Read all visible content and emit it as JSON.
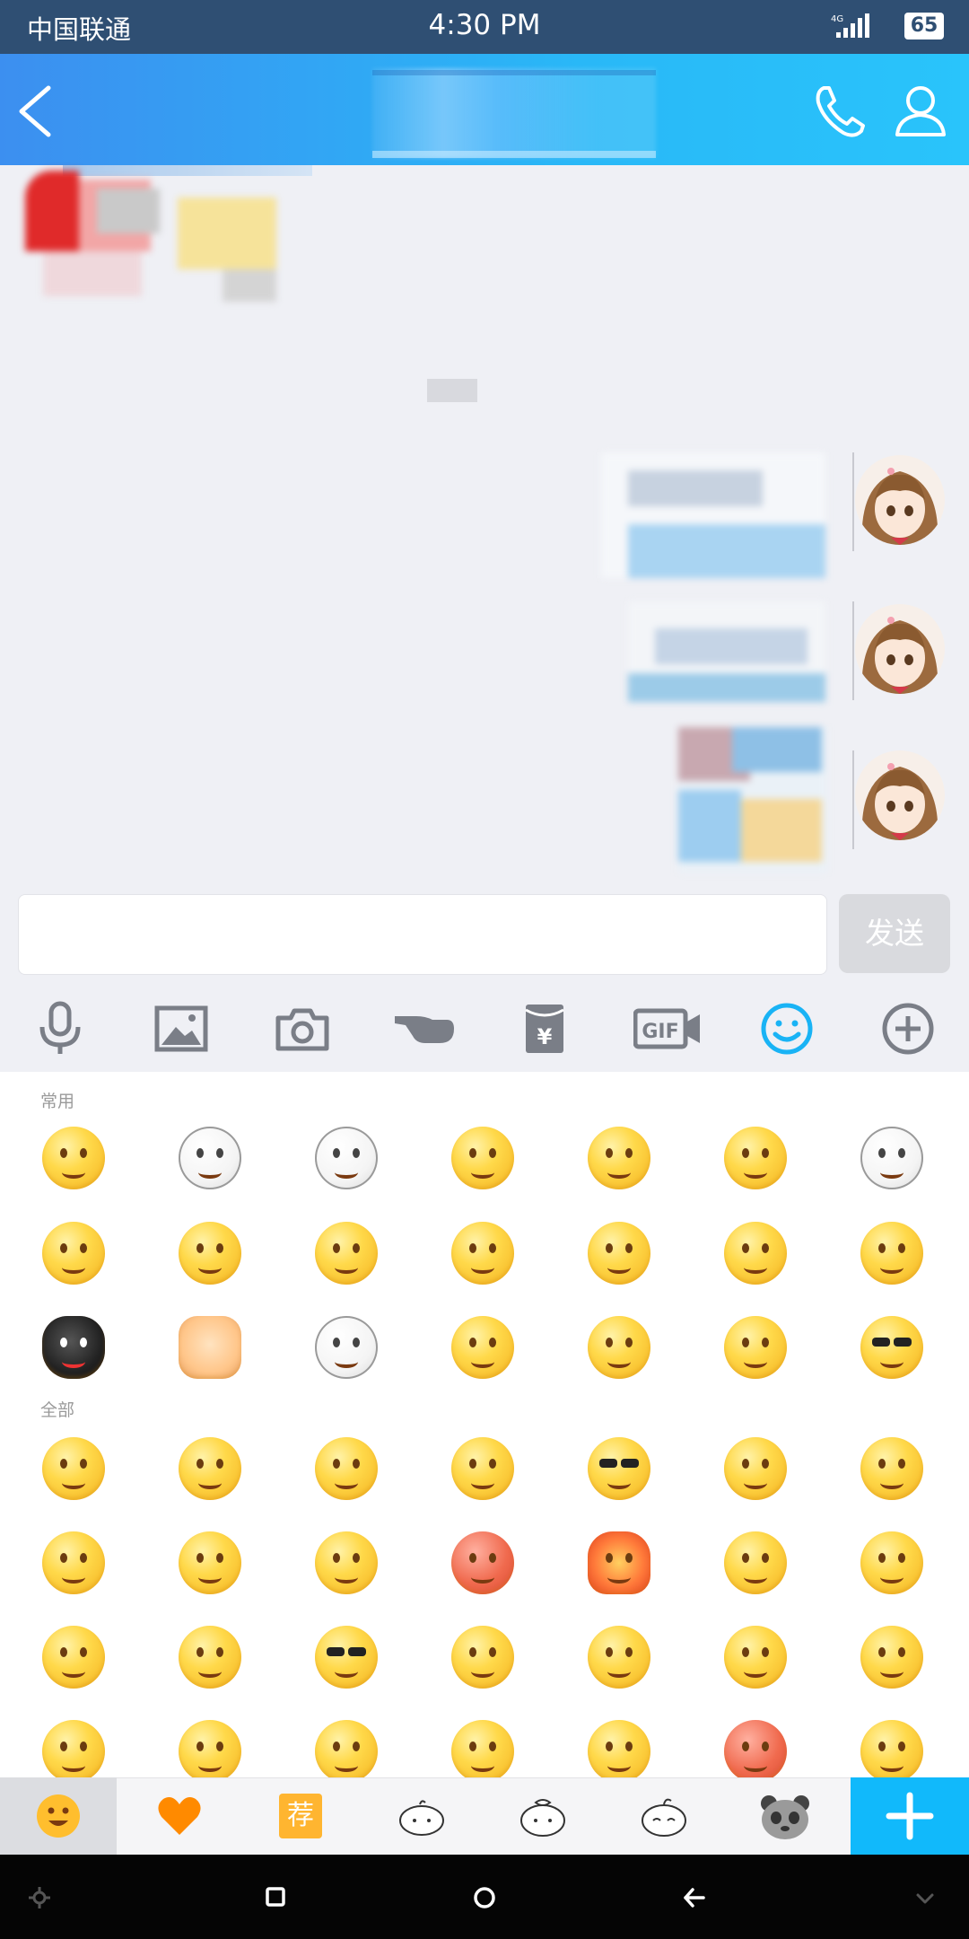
{
  "status_bar": {
    "carrier": "中国联通",
    "time": "4:30 PM",
    "network": "4G",
    "battery": "65"
  },
  "header": {
    "back_icon": "chevron-left-icon",
    "call_icon": "phone-icon",
    "profile_icon": "person-icon"
  },
  "chat": {
    "received_messages": 1,
    "sent_messages": 3
  },
  "composer": {
    "input_value": "",
    "send_label": "发送"
  },
  "toolbar": {
    "items": [
      "microphone-icon",
      "image-icon",
      "camera-icon",
      "poke-icon",
      "red-envelope-icon",
      "gif-icon",
      "emoji-icon",
      "plus-icon"
    ],
    "active": "emoji-icon"
  },
  "emoji_panel": {
    "section_recent": "常用",
    "section_all": "全部"
  },
  "emoji_tabs": {
    "items": [
      "smiley-icon",
      "heart-icon",
      "recommend-icon",
      "sticker-bun-1-icon",
      "sticker-bun-2-icon",
      "sticker-bun-3-icon",
      "panda-sticker-icon"
    ],
    "recommend_label": "荐",
    "add_icon": "plus-icon"
  },
  "colors": {
    "status_bg": "#2f4f73",
    "header_start": "#3c8ff0",
    "header_end": "#29c4fb",
    "accent": "#11b9fb",
    "chat_bg": "#eff0f5"
  }
}
